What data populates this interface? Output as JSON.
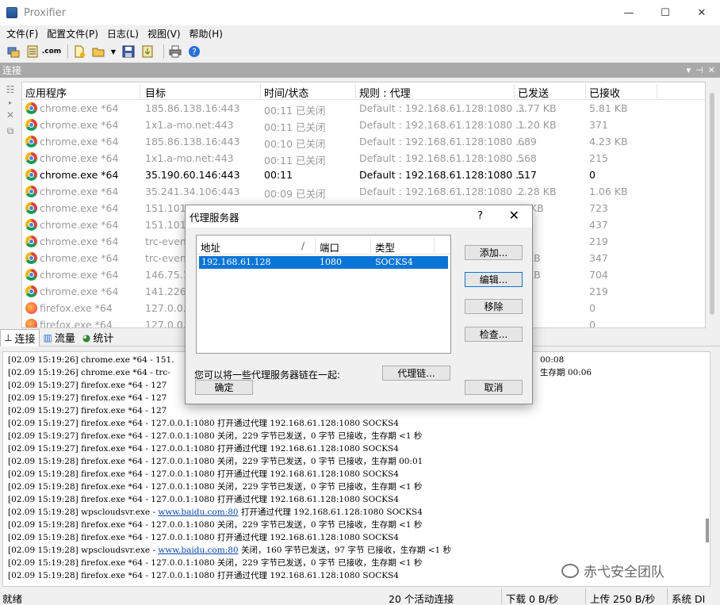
{
  "window": {
    "title": "Proxifier",
    "minimize": "—",
    "maximize": "☐",
    "close": "✕"
  },
  "menu": [
    "文件(F)",
    "配置文件(P)",
    "日志(L)",
    "视图(V)",
    "帮助(H)"
  ],
  "toolbar_icons": [
    "profile-icon",
    "rules-icon",
    "dns-icon",
    "new-icon",
    "open-icon",
    "save-icon",
    "import-icon",
    "print-icon",
    "help-icon"
  ],
  "panel": {
    "title": "连接",
    "ctrls": [
      "▾",
      "⊣",
      "✕"
    ]
  },
  "columns": [
    "应用程序",
    "目标",
    "时间/状态",
    "规则 : 代理",
    "已发送",
    "已接收"
  ],
  "connections": [
    {
      "icon": "chrome",
      "app": "chrome.exe *64",
      "target": "185.86.138.16:443",
      "time": "00:11 已关闭",
      "rule": "Default : 192.168.61.128:1080 ...",
      "sent": "3.77 KB",
      "recv": "5.81 KB",
      "active": false
    },
    {
      "icon": "chrome",
      "app": "chrome.exe *64",
      "target": "1x1.a-mo.net:443",
      "time": "00:11 已关闭",
      "rule": "Default : 192.168.61.128:1080 ...",
      "sent": "1.20 KB",
      "recv": "371",
      "active": false
    },
    {
      "icon": "chrome",
      "app": "chrome.exe *64",
      "target": "185.86.138.16:443",
      "time": "00:10 已关闭",
      "rule": "Default : 192.168.61.128:1080 ...",
      "sent": "689",
      "recv": "4.23 KB",
      "active": false
    },
    {
      "icon": "chrome",
      "app": "chrome.exe *64",
      "target": "1x1.a-mo.net:443",
      "time": "00:11 已关闭",
      "rule": "Default : 192.168.61.128:1080 ...",
      "sent": "568",
      "recv": "215",
      "active": false
    },
    {
      "icon": "chrome",
      "app": "chrome.exe *64",
      "target": "35.190.60.146:443",
      "time": "00:11",
      "rule": "Default : 192.168.61.128:1080 ...",
      "sent": "517",
      "recv": "0",
      "active": true
    },
    {
      "icon": "chrome",
      "app": "chrome.exe *64",
      "target": "35.241.34.106:443",
      "time": "00:09 已关闭",
      "rule": "Default : 192.168.61.128:1080 ...",
      "sent": "2.28 KB",
      "recv": "1.06 KB",
      "active": false
    },
    {
      "icon": "chrome",
      "app": "chrome.exe *64",
      "target": "151.101.1",
      "time": "",
      "rule": "",
      "sent": ".5 KB",
      "recv": "723",
      "active": false
    },
    {
      "icon": "chrome",
      "app": "chrome.exe *64",
      "target": "151.101.1",
      "time": "",
      "rule": "",
      "sent": "",
      "recv": "437",
      "active": false
    },
    {
      "icon": "chrome",
      "app": "chrome.exe *64",
      "target": "trc-event",
      "time": "",
      "rule": "",
      "sent": "3",
      "recv": "219",
      "active": false
    },
    {
      "icon": "chrome",
      "app": "chrome.exe *64",
      "target": "trc-event",
      "time": "",
      "rule": "",
      "sent": "8 KB",
      "recv": "347",
      "active": false
    },
    {
      "icon": "chrome",
      "app": "chrome.exe *64",
      "target": "146.75.11",
      "time": "",
      "rule": "",
      "sent": "6 KB",
      "recv": "704",
      "active": false
    },
    {
      "icon": "chrome",
      "app": "chrome.exe *64",
      "target": "141.226.2",
      "time": "",
      "rule": "",
      "sent": "3",
      "recv": "219",
      "active": false
    },
    {
      "icon": "firefox",
      "app": "firefox.exe *64",
      "target": "127.0.0.1",
      "time": "",
      "rule": "",
      "sent": "",
      "recv": "0",
      "active": false
    },
    {
      "icon": "firefox",
      "app": "firefox.exe *64",
      "target": "127.0.0.1",
      "time": "",
      "rule": "",
      "sent": "",
      "recv": "0",
      "active": false
    }
  ],
  "tabs": [
    {
      "icon": "⊥",
      "label": "连接"
    },
    {
      "icon": "▥",
      "label": "流量"
    },
    {
      "icon": "◕",
      "label": "统计"
    }
  ],
  "log": [
    {
      "text": "[02.09 15:19:26] chrome.exe *64 - 151.",
      "tail": "",
      "right": "00:08"
    },
    {
      "text": "[02.09 15:19:26] chrome.exe *64 - trc-",
      "tail": "",
      "right": "生存期 00:06"
    },
    {
      "text": "[02.09 15:19:27] firefox.exe *64 - 127",
      "tail": "",
      "right": ""
    },
    {
      "text": "[02.09 15:19:27] firefox.exe *64 - 127",
      "tail": "",
      "right": ""
    },
    {
      "text": "[02.09 15:19:27] firefox.exe *64 - 127",
      "tail": "",
      "right": ""
    },
    {
      "text": "[02.09 15:19:27] firefox.exe *64 - 127.0.0.1:1080 打开通过代理 192.168.61.128:1080 SOCKS4",
      "tail": "",
      "right": ""
    },
    {
      "text": "[02.09 15:19:27] firefox.exe *64 - 127.0.0.1:1080 关闭，229 字节已发送，0 字节 已接收，生存期 <1 秒",
      "tail": "",
      "right": ""
    },
    {
      "text": "[02.09 15:19:27] firefox.exe *64 - 127.0.0.1:1080 打开通过代理 192.168.61.128:1080 SOCKS4",
      "tail": "",
      "right": ""
    },
    {
      "text": "[02.09 15:19:28] firefox.exe *64 - 127.0.0.1:1080 关闭，229 字节已发送，0 字节 已接收，生存期 00:01",
      "tail": "",
      "right": ""
    },
    {
      "text": "[02.09 15:19:28] firefox.exe *64 - 127.0.0.1:1080 打开通过代理 192.168.61.128:1080 SOCKS4",
      "tail": "",
      "right": ""
    },
    {
      "text": "[02.09 15:19:28] firefox.exe *64 - 127.0.0.1:1080 关闭，229 字节已发送，0 字节 已接收，生存期 <1 秒",
      "tail": "",
      "right": ""
    },
    {
      "text": "[02.09 15:19:28] firefox.exe *64 - 127.0.0.1:1080 打开通过代理 192.168.61.128:1080 SOCKS4",
      "tail": "",
      "right": ""
    },
    {
      "text": "[02.09 15:19:28] wpscloudsvr.exe - ",
      "link": "www.baidu.com:80",
      "tail": " 打开通过代理 192.168.61.128:1080 SOCKS4",
      "right": ""
    },
    {
      "text": "[02.09 15:19:28] firefox.exe *64 - 127.0.0.1:1080 关闭，229 字节已发送，0 字节 已接收，生存期 <1 秒",
      "tail": "",
      "right": ""
    },
    {
      "text": "[02.09 15:19:28] firefox.exe *64 - 127.0.0.1:1080 打开通过代理 192.168.61.128:1080 SOCKS4",
      "tail": "",
      "right": ""
    },
    {
      "text": "[02.09 15:19:28] wpscloudsvr.exe - ",
      "link": "www.baidu.com:80",
      "tail": " 关闭，160 字节已发送，97 字节 已接收，生存期 <1 秒",
      "right": ""
    },
    {
      "text": "[02.09 15:19:28] firefox.exe *64 - 127.0.0.1:1080 关闭，229 字节已发送，0 字节 已接收，生存期 <1 秒",
      "tail": "",
      "right": ""
    },
    {
      "text": "[02.09 15:19:28] firefox.exe *64 - 127.0.0.1:1080 打开通过代理 192.168.61.128:1080 SOCKS4",
      "tail": "",
      "right": ""
    }
  ],
  "watermark": "赤弋安全团队",
  "status": {
    "left": "就绪",
    "connections": "20 个活动连接",
    "down": "下载 0 B/秒",
    "up": "上传 250 B/秒",
    "dns": "系统 DI"
  },
  "dialog": {
    "title": "代理服务器",
    "help": "?",
    "close": "✕",
    "columns": {
      "address": "地址",
      "sort": "/",
      "port": "端口",
      "type": "类型"
    },
    "row": {
      "address": "192.168.61.128",
      "port": "1080",
      "type": "SOCKS4"
    },
    "buttons": {
      "add": "添加...",
      "edit": "编辑...",
      "remove": "移除",
      "check": "检查...",
      "chain": "代理链...",
      "ok": "确定",
      "cancel": "取消"
    },
    "note": "您可以将一些代理服务器链在一起:"
  }
}
